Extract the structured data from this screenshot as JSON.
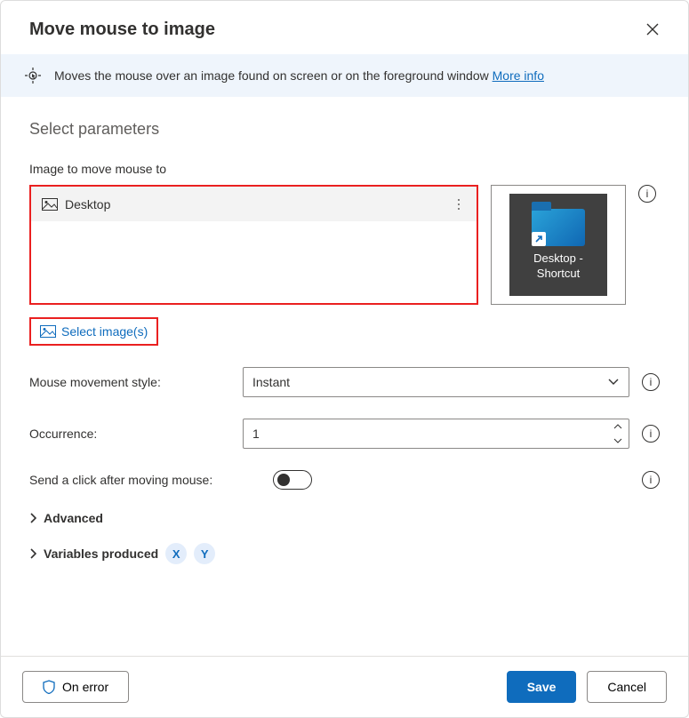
{
  "title": "Move mouse to image",
  "banner": {
    "text": "Moves the mouse over an image found on screen or on the foreground window ",
    "moreInfo": "More info"
  },
  "sectionTitle": "Select parameters",
  "imageField": {
    "label": "Image to move mouse to",
    "items": [
      {
        "name": "Desktop"
      }
    ],
    "preview": {
      "label1": "Desktop -",
      "label2": "Shortcut"
    },
    "selectButton": "Select image(s)"
  },
  "mouseStyle": {
    "label": "Mouse movement style:",
    "value": "Instant"
  },
  "occurrence": {
    "label": "Occurrence:",
    "value": "1"
  },
  "sendClick": {
    "label": "Send a click after moving mouse:",
    "value": false
  },
  "advanced": "Advanced",
  "varsProduced": {
    "label": "Variables produced",
    "vars": [
      "X",
      "Y"
    ]
  },
  "footer": {
    "onError": "On error",
    "save": "Save",
    "cancel": "Cancel"
  }
}
